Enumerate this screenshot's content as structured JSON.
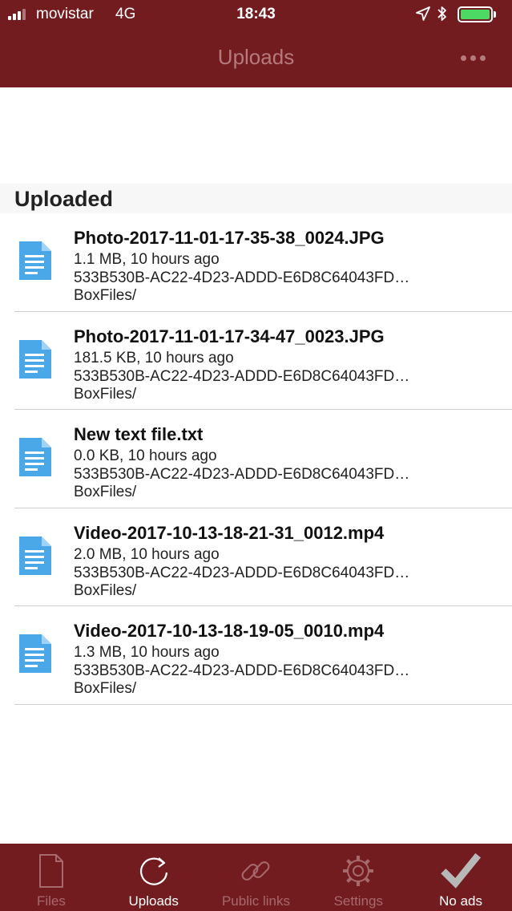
{
  "status_bar": {
    "carrier": "movistar",
    "network": "4G",
    "time": "18:43",
    "icons": [
      "signal-icon",
      "location-arrow-icon",
      "bluetooth-icon",
      "battery-icon"
    ],
    "battery_color": "#4cd964"
  },
  "nav": {
    "title": "Uploads",
    "more_icon": "more-dots-icon"
  },
  "section": {
    "title": "Uploaded"
  },
  "files": [
    {
      "name": "Photo-2017-11-01-17-35-38_0024.JPG",
      "meta": "1.1 MB, 10 hours ago",
      "id": "533B530B-AC22-4D23-ADDD-E6D8C64043FD…",
      "path": "BoxFiles/",
      "icon": "document-icon"
    },
    {
      "name": "Photo-2017-11-01-17-34-47_0023.JPG",
      "meta": "181.5 KB, 10 hours ago",
      "id": "533B530B-AC22-4D23-ADDD-E6D8C64043FD…",
      "path": "BoxFiles/",
      "icon": "document-icon"
    },
    {
      "name": "New text file.txt",
      "meta": "0.0 KB, 10 hours ago",
      "id": "533B530B-AC22-4D23-ADDD-E6D8C64043FD…",
      "path": "BoxFiles/",
      "icon": "document-icon"
    },
    {
      "name": "Video-2017-10-13-18-21-31_0012.mp4",
      "meta": "2.0 MB, 10 hours ago",
      "id": "533B530B-AC22-4D23-ADDD-E6D8C64043FD…",
      "path": "BoxFiles/",
      "icon": "document-icon"
    },
    {
      "name": "Video-2017-10-13-18-19-05_0010.mp4",
      "meta": "1.3 MB, 10 hours ago",
      "id": "533B530B-AC22-4D23-ADDD-E6D8C64043FD…",
      "path": "BoxFiles/",
      "icon": "document-icon"
    }
  ],
  "tabs": [
    {
      "label": "Files",
      "icon": "file-icon",
      "active": false
    },
    {
      "label": "Uploads",
      "icon": "refresh-arrow-icon",
      "active": true
    },
    {
      "label": "Public links",
      "icon": "link-icon",
      "active": false
    },
    {
      "label": "Settings",
      "icon": "gear-icon",
      "active": false
    },
    {
      "label": "No ads",
      "icon": "checkmark-icon",
      "active": false
    }
  ],
  "colors": {
    "brand": "#731c20",
    "doc_icon": "#4aa7e8",
    "tab_inactive": "#a66a6c",
    "tab_active": "#ffffff"
  }
}
